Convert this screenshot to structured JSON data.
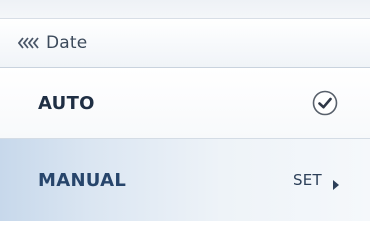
{
  "header": {
    "back_icon": "back-chevrons-icon",
    "title": "Date"
  },
  "options": {
    "auto": {
      "label": "AUTO",
      "selected": true,
      "icon": "checkmark-circle-icon"
    },
    "manual": {
      "label": "MANUAL",
      "action_label": "SET",
      "action_icon": "right-arrow-icon"
    }
  },
  "colors": {
    "text_dark": "#1f2f44",
    "text_accent": "#27456b",
    "highlight": "#c7d8eb"
  }
}
